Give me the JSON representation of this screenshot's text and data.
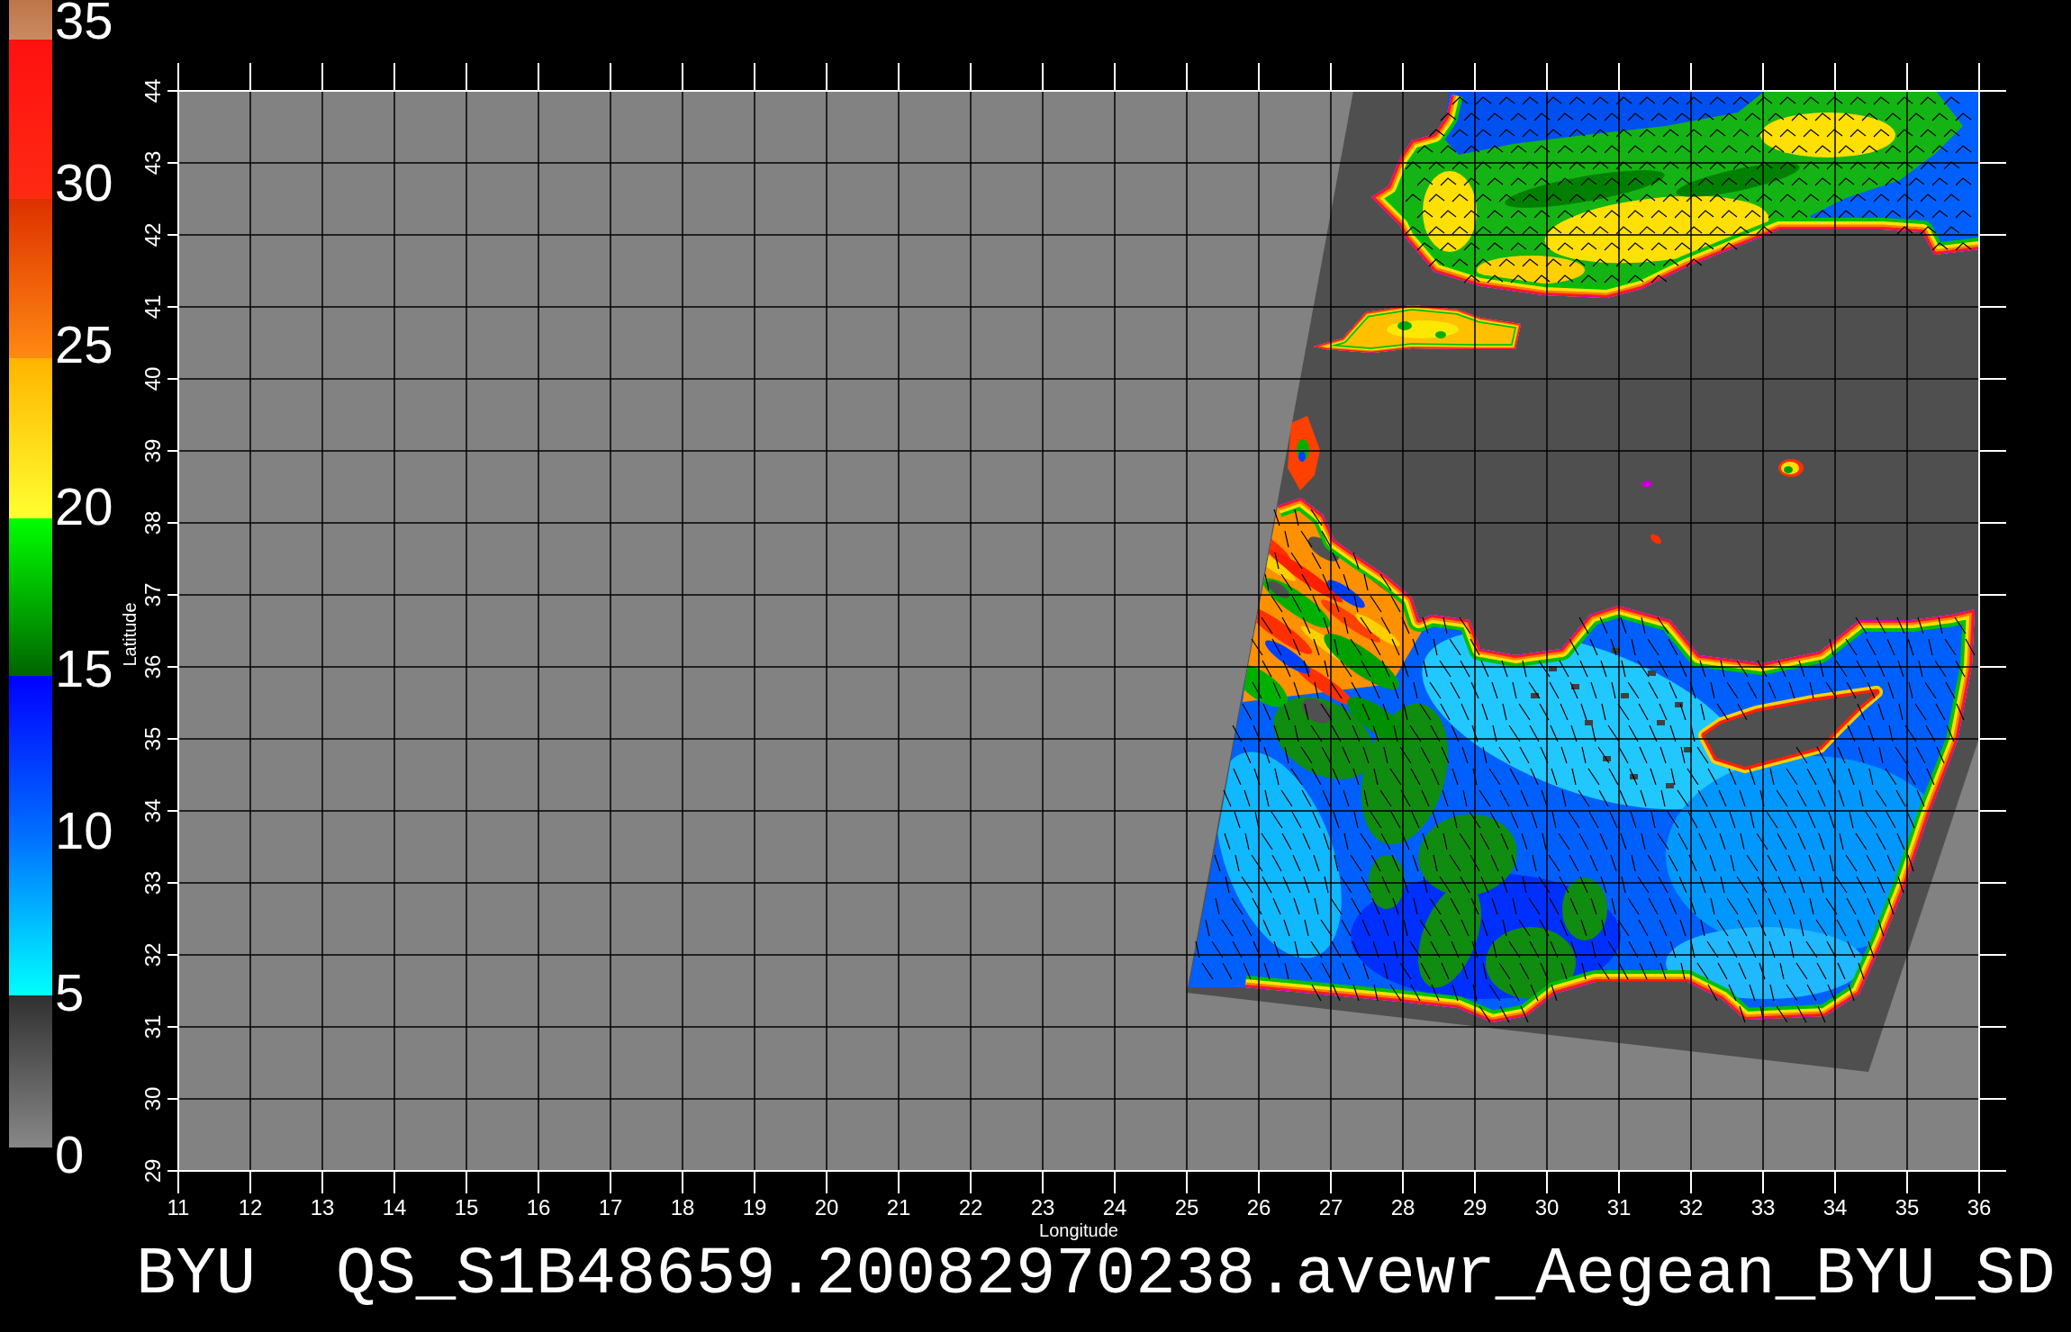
{
  "color_scale": {
    "labels": [
      "35",
      "30",
      "25",
      "20",
      "15",
      "10",
      "5",
      "0"
    ]
  },
  "map": {
    "y_axis": {
      "title": "Latitude",
      "ticks": [
        "44",
        "43",
        "42",
        "41",
        "40",
        "39",
        "38",
        "37",
        "36",
        "35",
        "34",
        "33",
        "32",
        "31",
        "30",
        "29"
      ]
    },
    "x_axis": {
      "ticks": [
        "11",
        "12",
        "13",
        "14",
        "15",
        "16",
        "17",
        "18",
        "19",
        "20",
        "21",
        "22",
        "23",
        "24",
        "25",
        "26",
        "27",
        "28",
        "29",
        "30",
        "31",
        "32",
        "33",
        "34",
        "35",
        "36"
      ],
      "title": "Longitude"
    }
  },
  "title": "BYU  QS_S1B48659.20082970238.avewr_Aegean_BYU_SD"
}
